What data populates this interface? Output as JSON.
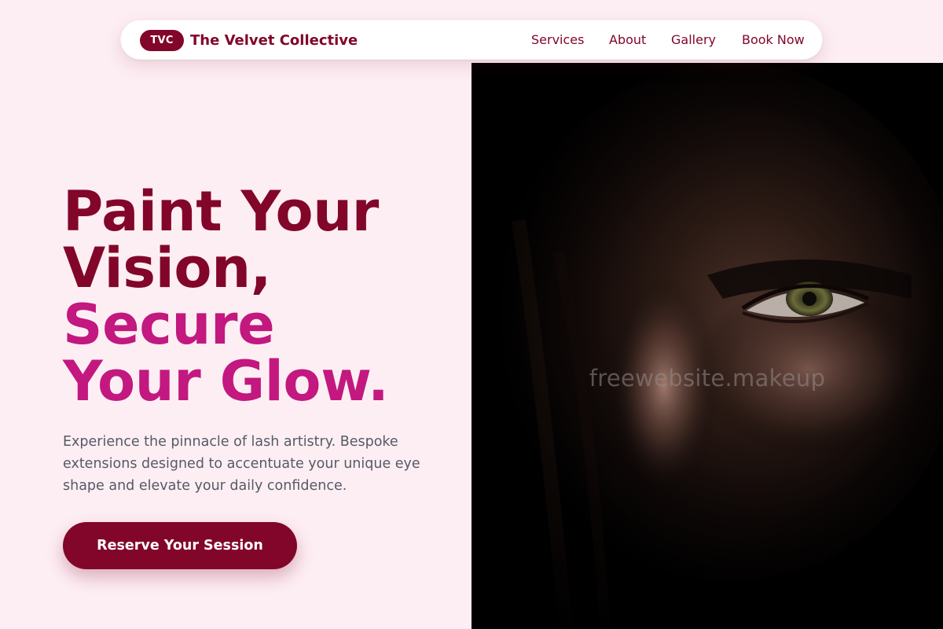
{
  "brand": {
    "badge": "TVC",
    "name": "The Velvet Collective"
  },
  "nav": {
    "items": [
      "Services",
      "About",
      "Gallery",
      "Book Now"
    ]
  },
  "hero": {
    "headline_lines": [
      "Paint Your",
      "Vision,",
      "Secure",
      "Your Glow."
    ],
    "description": "Experience the pinnacle of lash artistry. Bespoke extensions designed to accentuate your unique eye shape and elevate your daily confidence.",
    "cta_label": "Reserve Your Session",
    "image_watermark": "freewebsite.makeup",
    "image_subject": "dramatic low-key close-up portrait of a woman's eye"
  },
  "colors": {
    "background": "#fdeef3",
    "brand_primary": "#82062a",
    "accent_magenta": "#c2187f",
    "body_text": "#555a66",
    "nav_background": "#ffffff"
  },
  "icons": []
}
